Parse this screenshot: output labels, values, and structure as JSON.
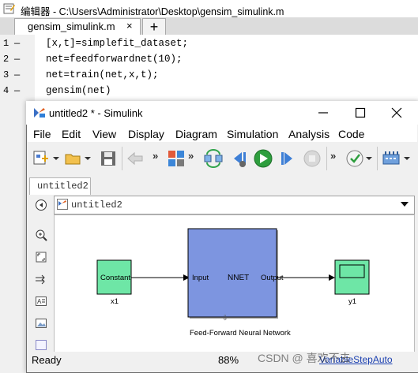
{
  "editor": {
    "window_title": "编辑器 - C:\\Users\\Administrator\\Desktop\\gensim_simulink.m",
    "tab_label": "gensim_simulink.m",
    "tab_close": "×",
    "tab_add": "+",
    "lines": [
      {
        "num": "1",
        "dash": "—",
        "code": "[x,t]=simplefit_dataset;"
      },
      {
        "num": "2",
        "dash": "—",
        "code": "net=feedforwardnet(10);"
      },
      {
        "num": "3",
        "dash": "—",
        "code": "net=train(net,x,t);"
      },
      {
        "num": "4",
        "dash": "—",
        "code": "gensim(net)"
      }
    ]
  },
  "simulink": {
    "window_title": "untitled2 * - Simulink",
    "menu": [
      "File",
      "Edit",
      "View",
      "Display",
      "Diagram",
      "Simulation",
      "Analysis",
      "Code"
    ],
    "toolbar_more": "»",
    "model_tab": "untitled2",
    "address": "untitled2",
    "blocks": {
      "constant": {
        "text": "Constant",
        "caption": "x1"
      },
      "nnet": {
        "input": "Input",
        "title": "NNET",
        "output": "Output",
        "caption": "Feed-Forward Neural Network"
      },
      "scope": {
        "caption": "y1"
      }
    },
    "status": {
      "left": "Ready",
      "zoom": "88%",
      "solver": "VariableStepAuto"
    }
  },
  "watermark": "CSDN @ 喜欢不去",
  "colors": {
    "constant_block": "#6ee6a6",
    "nnet_block": "#7d95e0",
    "scope_block": "#6ee6a6"
  }
}
